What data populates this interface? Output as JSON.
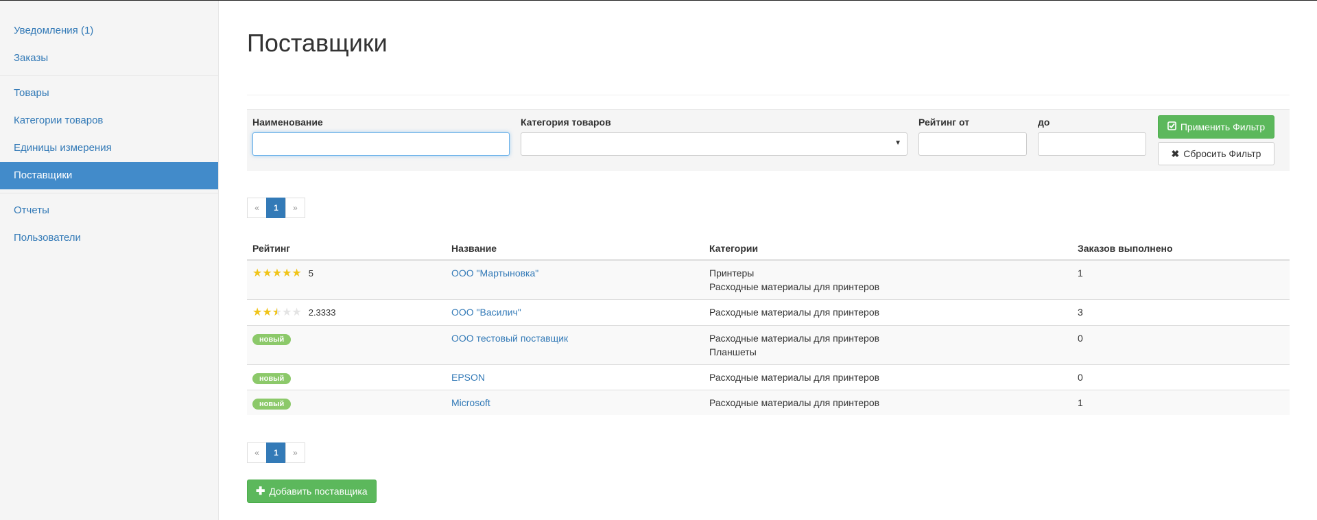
{
  "sidebar": {
    "group1": [
      {
        "label": "Уведомления (1)"
      },
      {
        "label": "Заказы"
      }
    ],
    "group2": [
      {
        "label": "Товары"
      },
      {
        "label": "Категории товаров"
      },
      {
        "label": "Единицы измерения"
      },
      {
        "label": "Поставщики",
        "active": true
      }
    ],
    "group3": [
      {
        "label": "Отчеты"
      },
      {
        "label": "Пользователи"
      }
    ]
  },
  "page": {
    "title": "Поставщики"
  },
  "filter": {
    "name_label": "Наименование",
    "name_value": "",
    "category_label": "Категория товаров",
    "category_value": "",
    "rating_from_label": "Рейтинг от",
    "rating_to_label": "до",
    "apply_label": "Применить Фильтр",
    "reset_label": "Сбросить Фильтр"
  },
  "pagination": {
    "prev": "«",
    "current": "1",
    "next": "»"
  },
  "table": {
    "headers": {
      "rating": "Рейтинг",
      "name": "Название",
      "categories": "Категории",
      "orders": "Заказов выполнено"
    },
    "rows": [
      {
        "stars": 5,
        "rating": "5",
        "badge": "",
        "name": "ООО \"Мартыновка\"",
        "categories": [
          "Принтеры",
          "Расходные материалы для принтеров"
        ],
        "orders": "1"
      },
      {
        "stars": 2.5,
        "rating": "2.3333",
        "badge": "",
        "name": "ООО \"Василич\"",
        "categories": [
          "Расходные материалы для принтеров"
        ],
        "orders": "3"
      },
      {
        "stars": null,
        "rating": "",
        "badge": "новый",
        "name": "ООО тестовый поставщик",
        "categories": [
          "Расходные материалы для принтеров",
          "Планшеты"
        ],
        "orders": "0"
      },
      {
        "stars": null,
        "rating": "",
        "badge": "новый",
        "name": "EPSON",
        "categories": [
          "Расходные материалы для принтеров"
        ],
        "orders": "0"
      },
      {
        "stars": null,
        "rating": "",
        "badge": "новый",
        "name": "Microsoft",
        "categories": [
          "Расходные материалы для принтеров"
        ],
        "orders": "1"
      }
    ]
  },
  "add_button": {
    "label": "Добавить поставщика"
  },
  "colors": {
    "accent": "#337ab7",
    "active_nav": "#428bca",
    "success": "#5cb85c",
    "badge": "#8cc96a",
    "star": "#f0c419"
  }
}
